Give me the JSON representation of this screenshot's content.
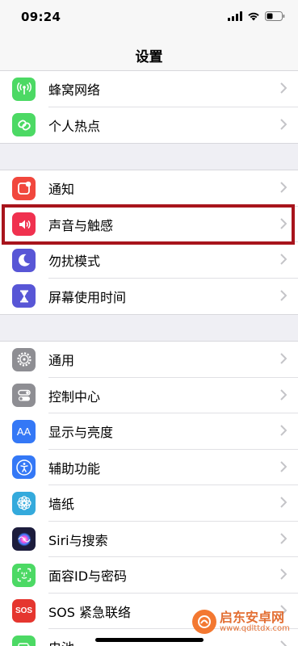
{
  "status_bar": {
    "time": "09:24"
  },
  "nav": {
    "title": "设置"
  },
  "groups": [
    {
      "items": [
        {
          "label": "蜂窝网络",
          "icon": "antenna-icon",
          "color": "#4cd964"
        },
        {
          "label": "个人热点",
          "icon": "link-icon",
          "color": "#4cd964"
        }
      ]
    },
    {
      "items": [
        {
          "label": "通知",
          "icon": "notification-icon",
          "color": "#f1473d"
        },
        {
          "label": "声音与触感",
          "icon": "speaker-icon",
          "color": "#f0314f",
          "highlighted": true
        },
        {
          "label": "勿扰模式",
          "icon": "moon-icon",
          "color": "#5856d6"
        },
        {
          "label": "屏幕使用时间",
          "icon": "hourglass-icon",
          "color": "#5856d6"
        }
      ]
    },
    {
      "items": [
        {
          "label": "通用",
          "icon": "gear-icon",
          "color": "#8e8e93"
        },
        {
          "label": "控制中心",
          "icon": "toggles-icon",
          "color": "#8e8e93"
        },
        {
          "label": "显示与亮度",
          "icon": "text-size-icon",
          "color": "#3478f6",
          "glyph": "AA"
        },
        {
          "label": "辅助功能",
          "icon": "accessibility-icon",
          "color": "#3478f6"
        },
        {
          "label": "墙纸",
          "icon": "flower-icon",
          "color": "#34aadc"
        },
        {
          "label": "Siri与搜索",
          "icon": "siri-icon",
          "color": "#1c1c3c"
        },
        {
          "label": "面容ID与密码",
          "icon": "face-id-icon",
          "color": "#4cd964"
        },
        {
          "label": "SOS 紧急联络",
          "icon": "sos-icon",
          "color": "#e5362f",
          "glyph": "SOS"
        },
        {
          "label": "电池",
          "icon": "battery-icon",
          "color": "#4cd964"
        }
      ]
    }
  ],
  "watermark": {
    "main": "启东安卓网",
    "sub": "www.qdlttdx.com"
  }
}
